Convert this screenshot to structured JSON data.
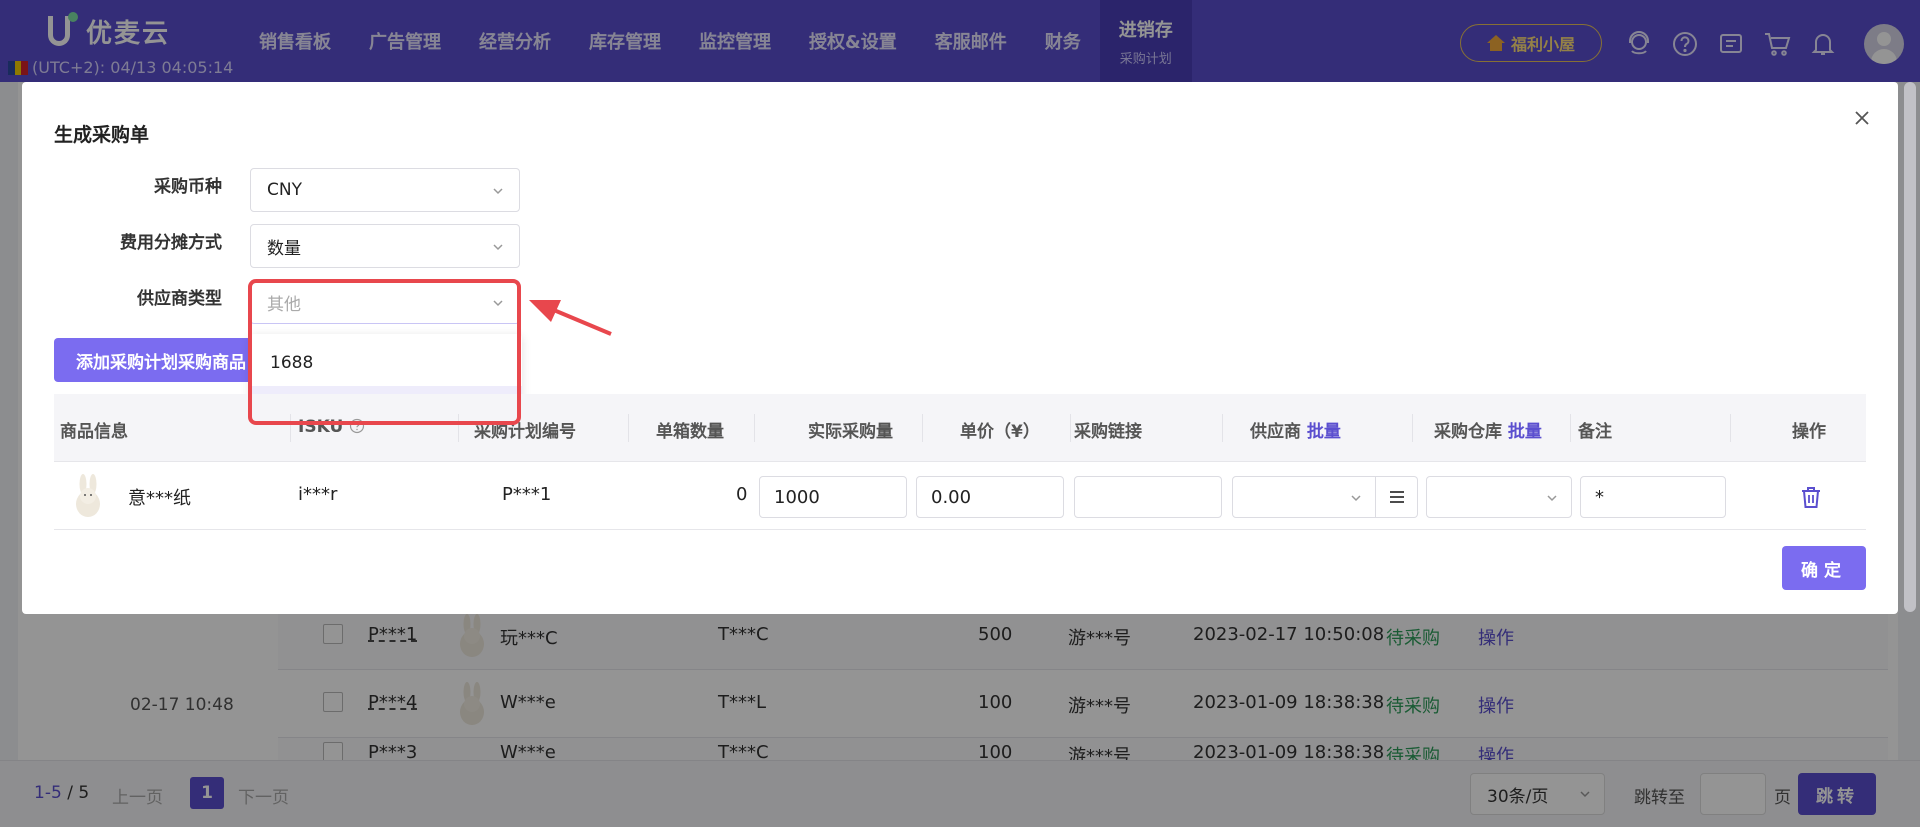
{
  "header": {
    "logo_text": "优麦云",
    "timezone": "(UTC+2): 04/13 04:05:14",
    "nav": [
      "销售看板",
      "广告管理",
      "经营分析",
      "库存管理",
      "监控管理",
      "授权&设置",
      "客服邮件",
      "财务"
    ],
    "nav_active": {
      "label": "进销存",
      "sub": "采购计划"
    },
    "welfare": "福利小屋",
    "icons": [
      "support-icon",
      "help-icon",
      "notes-icon",
      "cart-icon",
      "bell-icon",
      "avatar"
    ],
    "colors": {
      "brand": "#5b4fcf",
      "accent": "#7b6cf0",
      "highlight": "#e8474d",
      "success": "#2e9e5b"
    }
  },
  "background": {
    "date": "02-17 10:48",
    "rows": [
      {
        "plan": "P***1",
        "name": "玩***C",
        "sku": "T***C",
        "qty": "500",
        "creator": "游***号",
        "time": "2023-02-17 10:50:08",
        "status": "待采购",
        "op": "操作"
      },
      {
        "plan": "P***4",
        "name": "W***e",
        "sku": "T***L",
        "qty": "100",
        "creator": "游***号",
        "time": "2023-01-09 18:38:38",
        "status": "待采购",
        "op": "操作"
      },
      {
        "plan": "P***3",
        "name": "W***e",
        "sku": "T***C",
        "qty": "100",
        "creator": "游***号",
        "time": "2023-01-09 18:38:38",
        "status": "待采购",
        "op": "操作"
      }
    ],
    "pager": {
      "range": "1-5",
      "sep": "/",
      "total": "5",
      "prev": "上一页",
      "page": "1",
      "next": "下一页",
      "page_size": "30条/页",
      "jump": "跳转至",
      "page_suffix": "页",
      "go": "跳转"
    }
  },
  "modal": {
    "title": "生成采购单",
    "currency_label": "采购币种",
    "currency_value": "CNY",
    "allocation_label": "费用分摊方式",
    "allocation_value": "数量",
    "supplier_type_label": "供应商类型",
    "supplier_type_value": "其他",
    "supplier_type_options": [
      "1688",
      "其他"
    ],
    "add_button": "添加采购计划采购商品",
    "confirm": "确定",
    "columns": {
      "product": "商品信息",
      "isku": "ISKU",
      "plan_no": "采购计划编号",
      "box_qty": "单箱数量",
      "actual_qty": "实际采购量",
      "unit_price": "单价（¥）",
      "link": "采购链接",
      "supplier": "供应商",
      "warehouse": "采购仓库",
      "batch": "批量",
      "remark": "备注",
      "action": "操作"
    },
    "row": {
      "product_name": "意***纸",
      "isku": "i***r",
      "plan_no": "P***1",
      "box_qty": "0",
      "actual_qty": "1000",
      "unit_price": "0.00",
      "link": "",
      "remark": "*"
    }
  }
}
